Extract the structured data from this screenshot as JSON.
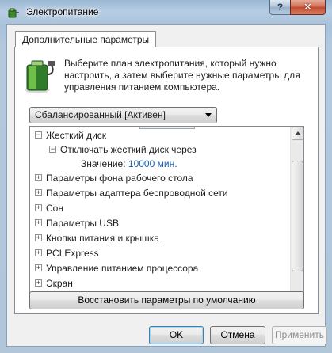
{
  "window": {
    "title": "Электропитание",
    "help_label": "?",
    "close_label": "✕"
  },
  "tab": {
    "label": "Дополнительные параметры"
  },
  "description": "Выберите план электропитания, который нужно настроить, а затем выберите нужные параметры для управления питанием компьютера.",
  "plan_select": {
    "selected": "Сбалансированный [Активен]"
  },
  "tree": {
    "items": [
      {
        "expander": "−",
        "label": "Жесткий диск"
      },
      {
        "expander": "−",
        "label": "Отключать жесткий диск через"
      },
      {
        "value_label": "Значение:",
        "value": "10000 мин."
      },
      {
        "expander": "+",
        "label": "Параметры фона рабочего стола"
      },
      {
        "expander": "+",
        "label": "Параметры адаптера беспроводной сети"
      },
      {
        "expander": "+",
        "label": "Сон"
      },
      {
        "expander": "+",
        "label": "Параметры USB"
      },
      {
        "expander": "+",
        "label": "Кнопки питания и крышка"
      },
      {
        "expander": "+",
        "label": "PCI Express"
      },
      {
        "expander": "+",
        "label": "Управление питанием процессора"
      },
      {
        "expander": "+",
        "label": "Экран"
      }
    ]
  },
  "buttons": {
    "restore": "Восстановить параметры по умолчанию",
    "ok": "OK",
    "cancel": "Отмена",
    "apply": "Применить"
  },
  "colors": {
    "link_value": "#1a5fb4",
    "close_button": "#c14a2f"
  },
  "icons": [
    "power-app-icon",
    "battery-plug-icon",
    "dropdown-arrow-icon",
    "collapse-icon",
    "expand-icon",
    "scroll-up-icon",
    "scroll-down-icon"
  ]
}
